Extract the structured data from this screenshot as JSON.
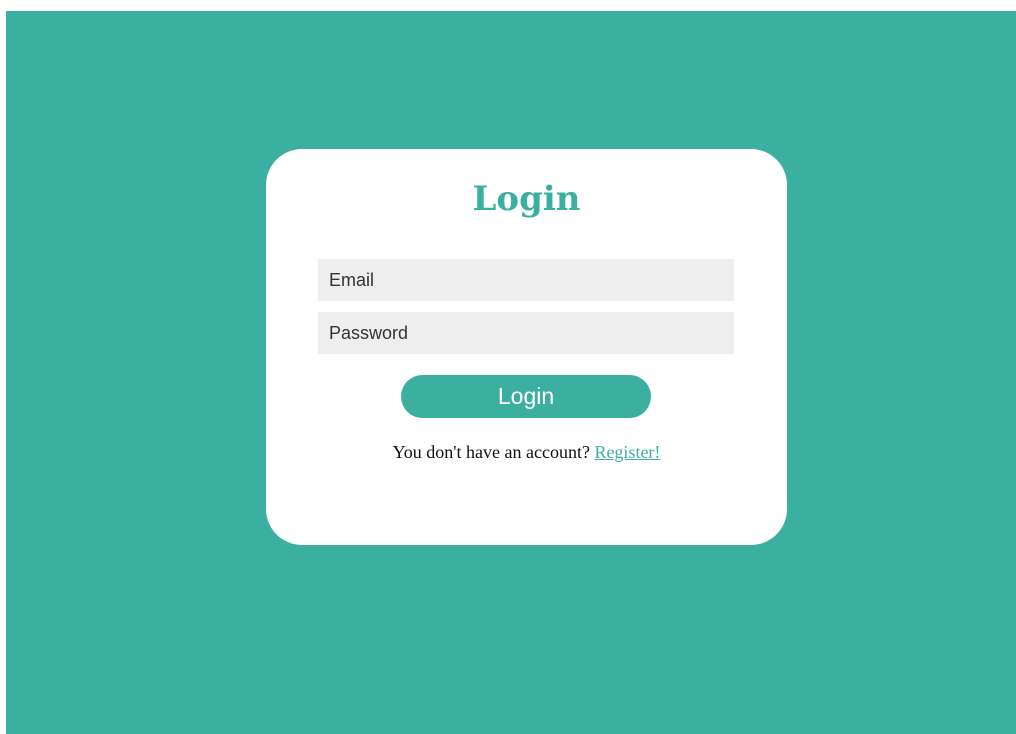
{
  "theme": {
    "accent": "#3cb0a0",
    "background": "#3cb0a0",
    "card": "#ffffff",
    "field_bg": "#eeeeee"
  },
  "login_form": {
    "title": "Login",
    "email_placeholder": "Email",
    "password_placeholder": "Password",
    "submit_label": "Login",
    "footer_text": "You don't have an account?",
    "register_link_label": "Register!"
  }
}
